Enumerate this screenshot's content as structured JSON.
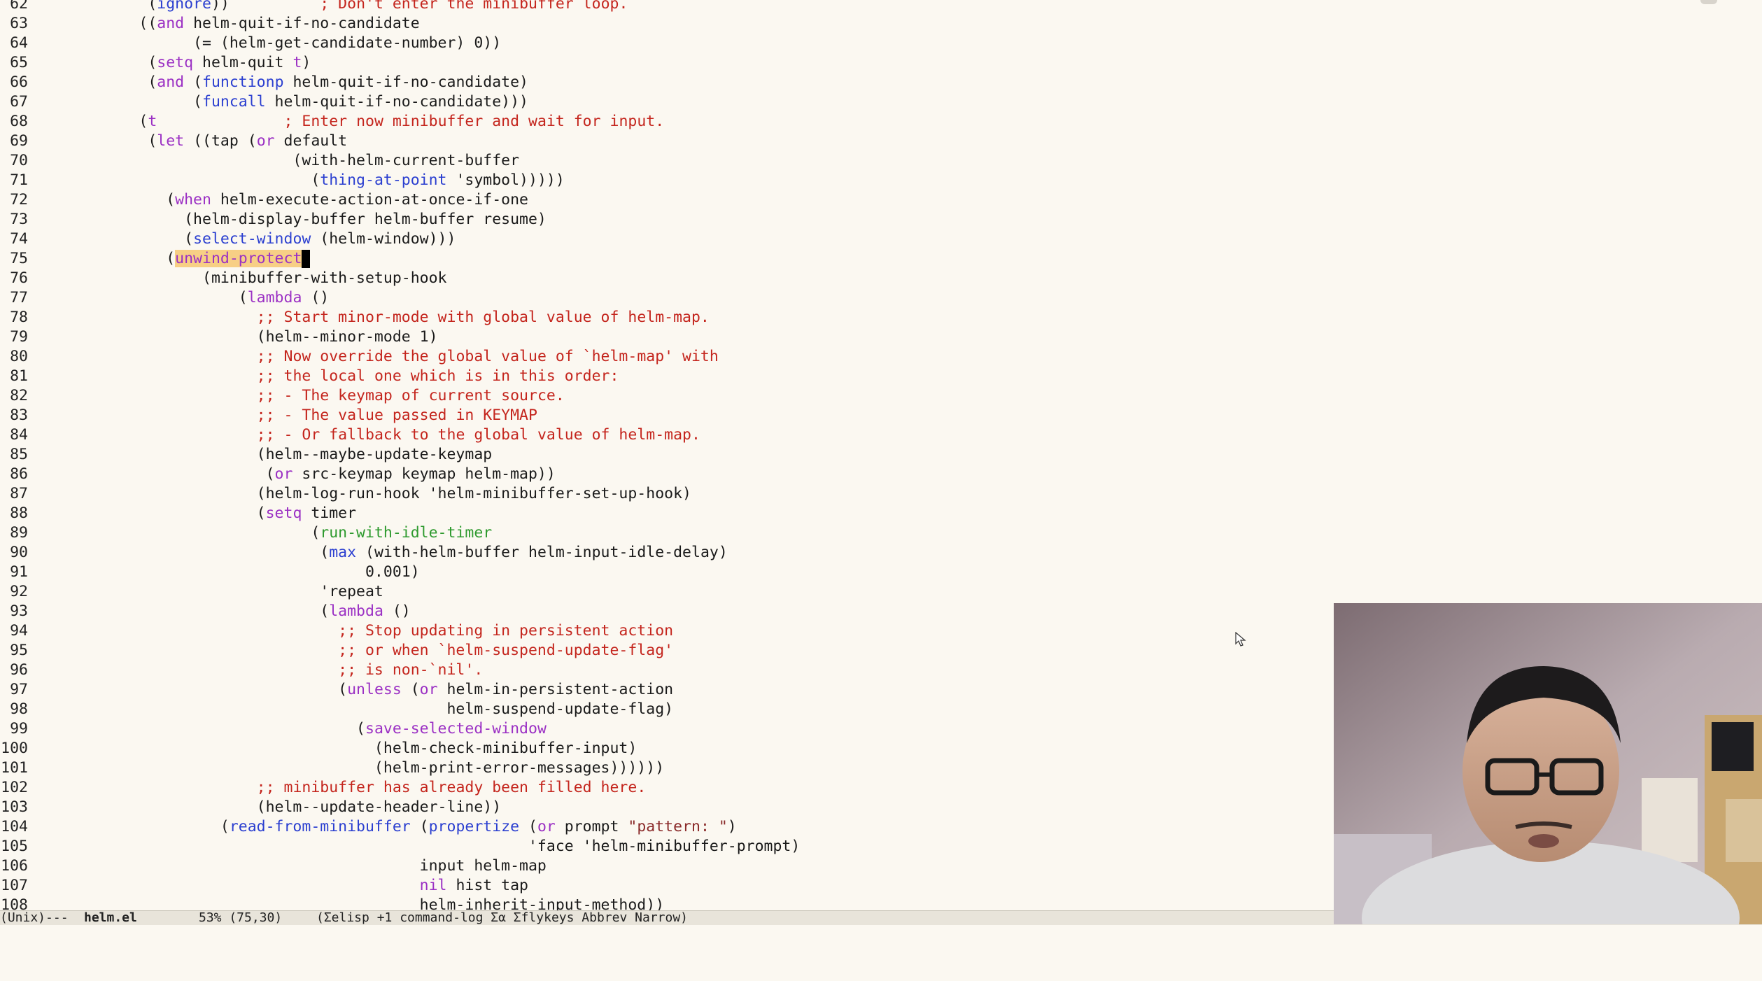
{
  "editor": {
    "lines": [
      {
        "n": "62",
        "code": "            (<span class=\"fn\">ignore</span>))          <span class=\"cm\">; Don't enter the minibuffer loop.</span>"
      },
      {
        "n": "63",
        "code": "           ((<span class=\"kw\">and</span> helm-quit-if-no-candidate"
      },
      {
        "n": "64",
        "code": "                 (= (helm-get-candidate-number) 0))"
      },
      {
        "n": "65",
        "code": "            (<span class=\"kw\">setq</span> helm-quit <span class=\"kw\">t</span>)"
      },
      {
        "n": "66",
        "code": "            (<span class=\"kw\">and</span> (<span class=\"fn\">functionp</span> helm-quit-if-no-candidate)"
      },
      {
        "n": "67",
        "code": "                 (<span class=\"fn\">funcall</span> helm-quit-if-no-candidate)))"
      },
      {
        "n": "68",
        "code": "           (<span class=\"kw\">t</span>              <span class=\"cm\">; Enter now minibuffer and wait for input.</span>"
      },
      {
        "n": "69",
        "code": "            (<span class=\"kw\">let</span> ((tap (<span class=\"kw\">or</span> default"
      },
      {
        "n": "70",
        "code": "                            (with-helm-current-buffer"
      },
      {
        "n": "71",
        "code": "                              (<span class=\"fn\">thing-at-point</span> 'symbol)))))"
      },
      {
        "n": "72",
        "code": "              (<span class=\"kw\">when</span> helm-execute-action-at-once-if-one"
      },
      {
        "n": "73",
        "code": "                (helm-display-buffer helm-buffer resume)"
      },
      {
        "n": "74",
        "code": "                (<span class=\"fn\">select-window</span> (helm-window)))"
      },
      {
        "n": "75",
        "code": "              (<span class=\"hl\">unwind-protect</span><span class=\"cursor\" data-name=\"text-cursor\" data-interactable=\"false\"></span>"
      },
      {
        "n": "76",
        "code": "                  (minibuffer-with-setup-hook"
      },
      {
        "n": "77",
        "code": "                      (<span class=\"kw\">lambda</span> ()"
      },
      {
        "n": "78",
        "code": "                        <span class=\"cm\">;; Start minor-mode with global value of helm-map.</span>"
      },
      {
        "n": "79",
        "code": "                        (helm--minor-mode 1)"
      },
      {
        "n": "80",
        "code": "                        <span class=\"cm\">;; Now override the global value of `helm-map' with</span>"
      },
      {
        "n": "81",
        "code": "                        <span class=\"cm\">;; the local one which is in this order:</span>"
      },
      {
        "n": "82",
        "code": "                        <span class=\"cm\">;; - The keymap of current source.</span>"
      },
      {
        "n": "83",
        "code": "                        <span class=\"cm\">;; - The value passed in KEYMAP</span>"
      },
      {
        "n": "84",
        "code": "                        <span class=\"cm\">;; - Or fallback to the global value of helm-map.</span>"
      },
      {
        "n": "85",
        "code": "                        (helm--maybe-update-keymap"
      },
      {
        "n": "86",
        "code": "                         (<span class=\"kw\">or</span> src-keymap keymap helm-map))"
      },
      {
        "n": "87",
        "code": "                        (helm-log-run-hook 'helm-minibuffer-set-up-hook)"
      },
      {
        "n": "88",
        "code": "                        (<span class=\"kw\">setq</span> timer"
      },
      {
        "n": "89",
        "code": "                              (<span class=\"grn\">run-with-idle-timer</span>"
      },
      {
        "n": "90",
        "code": "                               (<span class=\"fn\">max</span> (with-helm-buffer helm-input-idle-delay)"
      },
      {
        "n": "91",
        "code": "                                    0.001)"
      },
      {
        "n": "92",
        "code": "                               'repeat"
      },
      {
        "n": "93",
        "code": "                               (<span class=\"kw\">lambda</span> ()"
      },
      {
        "n": "94",
        "code": "                                 <span class=\"cm\">;; Stop updating in persistent action</span>"
      },
      {
        "n": "95",
        "code": "                                 <span class=\"cm\">;; or when `helm-suspend-update-flag'</span>"
      },
      {
        "n": "96",
        "code": "                                 <span class=\"cm\">;; is non-`nil'.</span>"
      },
      {
        "n": "97",
        "code": "                                 (<span class=\"kw\">unless</span> (<span class=\"kw\">or</span> helm-in-persistent-action"
      },
      {
        "n": "98",
        "code": "                                             helm-suspend-update-flag)"
      },
      {
        "n": "99",
        "code": "                                   (<span class=\"kw\">save-selected-window</span>"
      },
      {
        "n": "100",
        "code": "                                     (helm-check-minibuffer-input)"
      },
      {
        "n": "101",
        "code": "                                     (helm-print-error-messages))))))"
      },
      {
        "n": "102",
        "code": "                        <span class=\"cm\">;; minibuffer has already been filled here.</span>"
      },
      {
        "n": "103",
        "code": "                        (helm--update-header-line))"
      },
      {
        "n": "104",
        "code": "                    (<span class=\"fn\">read-from-minibuffer</span> (<span class=\"fn\">propertize</span> (<span class=\"kw\">or</span> prompt <span class=\"str\">\"pattern: \"</span>)"
      },
      {
        "n": "105",
        "code": "                                                      'face 'helm-minibuffer-prompt)"
      },
      {
        "n": "106",
        "code": "                                          input helm-map"
      },
      {
        "n": "107",
        "code": "                                          <span class=\"kw\">nil</span> hist tap"
      },
      {
        "n": "108",
        "code": "                                          helm-inherit-input-method))"
      }
    ]
  },
  "modeline": {
    "eol": "(Unix)---",
    "filename": "helm.el",
    "position": "53% (75,30)",
    "modes": "(Σelisp +1 command-log Σα Σflykeys Abbrev Narrow)"
  },
  "colors": {
    "background": "#fbf8f1",
    "keyword": "#9b30c4",
    "function": "#2b3fd0",
    "comment": "#c4251d",
    "highlight": "#f7cf85"
  },
  "icons": {
    "pointer": "mouse-pointer-icon"
  }
}
